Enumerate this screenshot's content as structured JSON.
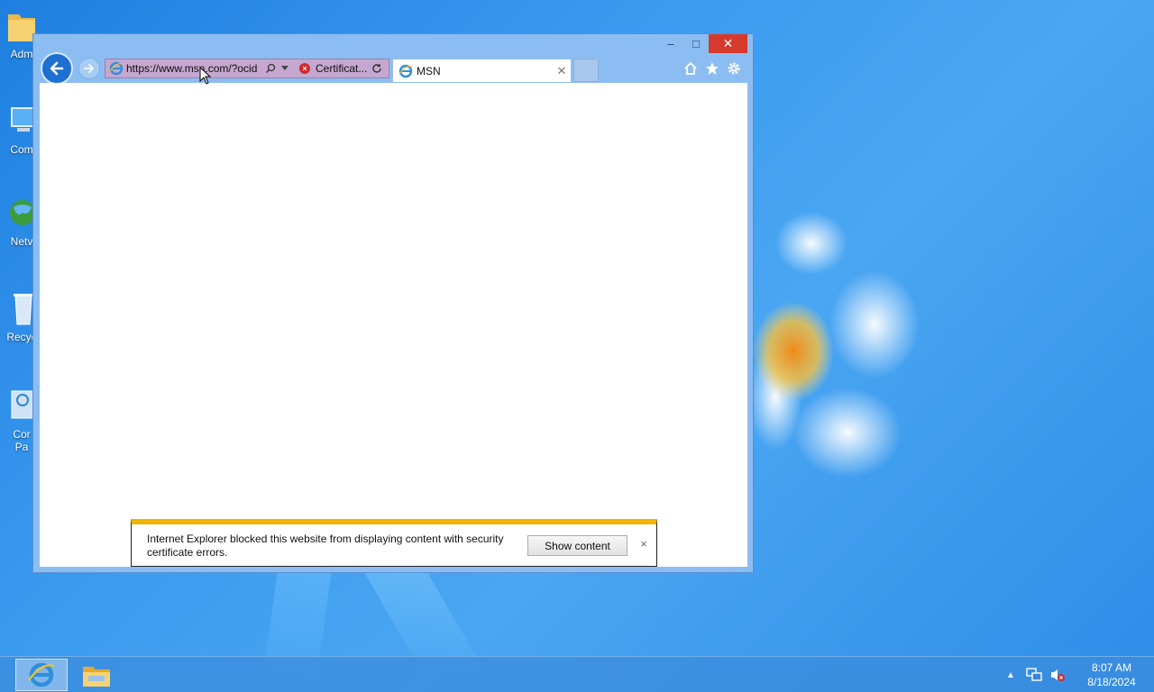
{
  "desktop": {
    "icons": [
      {
        "label": "Adm",
        "icon": "folder-icon"
      },
      {
        "label": "Com",
        "icon": "computer-icon"
      },
      {
        "label": "Netv",
        "icon": "network-icon"
      },
      {
        "label": "Recyc",
        "icon": "recycle-bin-icon"
      },
      {
        "label": "Cor",
        "label2": "Pa",
        "icon": "control-panel-icon"
      }
    ]
  },
  "browser": {
    "address": {
      "url": "https://www.msn.com/?ocid",
      "certificate_label": "Certificat..."
    },
    "tab": {
      "title": "MSN"
    },
    "window_controls": {
      "minimize": "–",
      "maximize": "□",
      "close": "✕"
    }
  },
  "notification": {
    "message": "Internet Explorer blocked this website from displaying content with security certificate errors.",
    "show_button_label": "Show content",
    "close": "×"
  },
  "taskbar": {
    "apps": [
      {
        "name": "Internet Explorer",
        "icon": "internet-explorer-icon",
        "active": true
      },
      {
        "name": "File Explorer",
        "icon": "file-explorer-icon",
        "active": false
      }
    ],
    "clock": {
      "time": "8:07 AM",
      "date": "8/18/2024"
    }
  },
  "colors": {
    "accent": "#1d6fd1",
    "cert_error_bar": "#c5a7cf",
    "notification_border": "#f0b400",
    "close_button": "#d63a2c"
  }
}
